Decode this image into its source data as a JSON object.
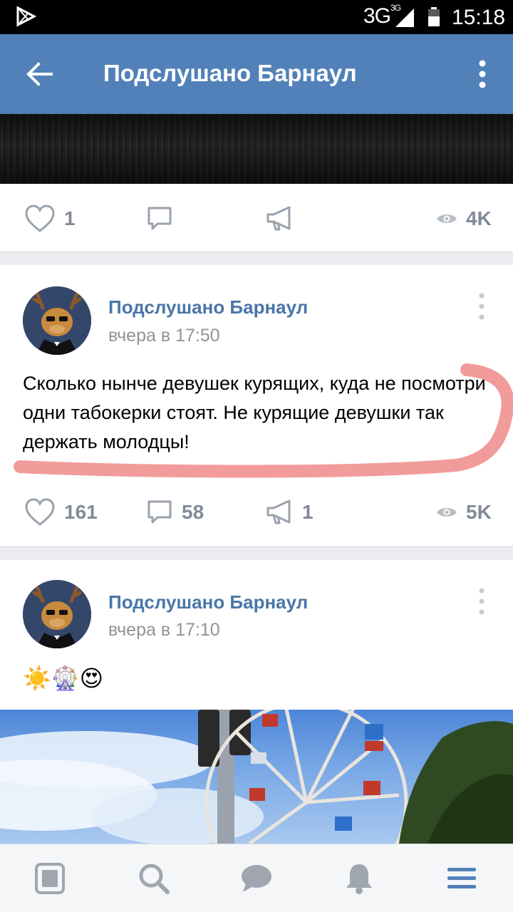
{
  "status_bar": {
    "network": "3G",
    "network_sup": "3G",
    "time": "15:18"
  },
  "header": {
    "title": "Подслушано Барнаул"
  },
  "top_post_actions": {
    "likes": "1",
    "views": "4K"
  },
  "posts": [
    {
      "author": "Подслушано Барнаул",
      "time": "вчера в 17:50",
      "text": "Сколько нынче девушек курящих, куда не посмотри одни табокерки стоят. Не курящие девушки так держать молодцы!",
      "likes": "161",
      "comments": "58",
      "reposts": "1",
      "views": "5K"
    },
    {
      "author": "Подслушано Барнаул",
      "time": "вчера в 17:10",
      "emoji": "☀️🎡😍"
    }
  ],
  "bottom_nav": [
    "news-icon",
    "search-icon",
    "messages-icon",
    "notifications-icon",
    "menu-icon"
  ],
  "colors": {
    "header": "#5181b8",
    "link": "#4a76a8",
    "muted": "#828a99",
    "highlight": "#f08080"
  }
}
